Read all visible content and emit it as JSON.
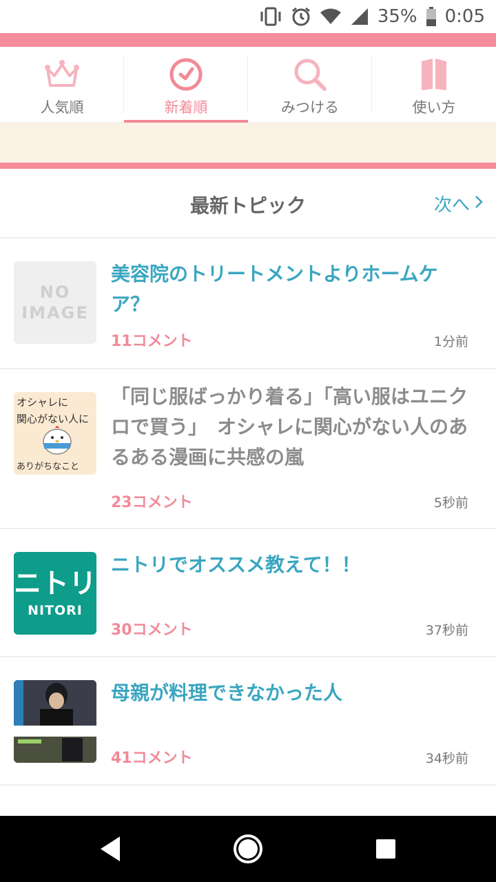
{
  "status": {
    "battery": "35%",
    "time": "0:05",
    "icons": [
      "vibrate-icon",
      "alarm-icon",
      "wifi-icon",
      "signal-icon",
      "battery-icon"
    ]
  },
  "tabs": [
    {
      "label": "人気順",
      "icon": "crown-icon",
      "active": false
    },
    {
      "label": "新着順",
      "icon": "clock-icon",
      "active": true
    },
    {
      "label": "みつける",
      "icon": "search-icon",
      "active": false
    },
    {
      "label": "使い方",
      "icon": "book-icon",
      "active": false
    }
  ],
  "section": {
    "title": "最新トピック",
    "next_label": "次へ"
  },
  "thumbs": {
    "noimage_line1": "NO",
    "noimage_line2": "IMAGE",
    "manga_line1": "オシャレに",
    "manga_line2": "関心がない人に",
    "manga_line3": "ありがちなこと",
    "nitori_big": "ニトリ",
    "nitori_small": "NITORI"
  },
  "topics": [
    {
      "title": "美容院のトリートメントよりホームケア？",
      "comments": "11コメント",
      "time": "1分前"
    },
    {
      "title": "「同じ服ばっかり着る」「高い服はユニクロで買う」　オシャレに関心がない人のあるある漫画に共感の嵐",
      "comments": "23コメント",
      "time": "5秒前"
    },
    {
      "title": "ニトリでオススメ教えて！！",
      "comments": "30コメント",
      "time": "37秒前"
    },
    {
      "title": "母親が料理できなかった人",
      "comments": "41コメント",
      "time": "34秒前"
    }
  ],
  "colors": {
    "accent_pink": "#f28a98",
    "accent_blue": "#3aa6c0",
    "cream": "#fbf2e6",
    "nitori_green": "#0e9c8b"
  }
}
